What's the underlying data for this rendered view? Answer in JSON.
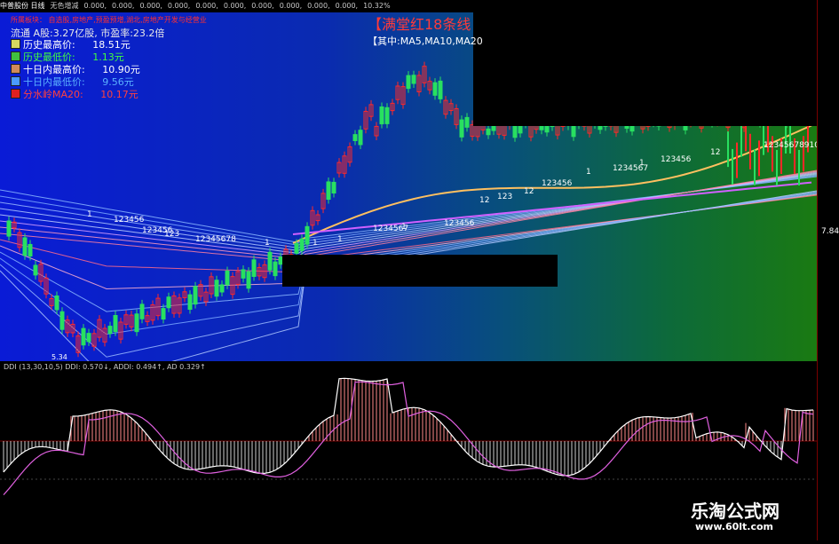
{
  "topbar": {
    "items": [
      "中普股份 日线",
      "无色增减",
      "0.000,",
      "0.000,",
      "0.000,",
      "0.000,",
      "0.000,",
      "0.000,",
      "0.000,",
      "0.000,",
      "0.000,",
      "0.000,",
      "10.32%"
    ]
  },
  "info": {
    "sector": "所属板块：  自选股,房地产,预盈预增,湖北,房地产开发与经营业",
    "flow": "流通 A股:3.27亿股,    市盈率:23.2倍",
    "legend": [
      {
        "label": "历史最高价:",
        "value": "18.51元",
        "color": "#d8d860",
        "text_color": "#ffffff"
      },
      {
        "label": "历史最低价:",
        "value": "1.13元",
        "color": "#40c040",
        "text_color": "#40ff40"
      },
      {
        "label": "十日内最高价:",
        "value": "10.90元",
        "color": "#d08a5a",
        "text_color": "#ffffff"
      },
      {
        "label": "十日内最低价:",
        "value": "9.56元",
        "color": "#4a9aff",
        "text_color": "#5ab0ff"
      },
      {
        "label": "分水岭MA20:",
        "value": "10.17元",
        "color": "#e02020",
        "text_color": "#ff4040"
      }
    ]
  },
  "banner": {
    "title": "【满堂红18条线",
    "subtitle": "【其中:MA5,MA10,MA20"
  },
  "chart_labels": {
    "upper_counts": [
      "1",
      "123456",
      "123456",
      "123",
      "12345678",
      "1",
      "1",
      "1",
      "1234567",
      "1",
      "123456",
      "12",
      "123",
      "12",
      "123456",
      "1",
      "1234567",
      "1",
      "123456",
      "12",
      "12345678910"
    ],
    "low_price": "5.34",
    "right_price": "7.84"
  },
  "indicator": {
    "header": "DDI (13,30,10,5)  DDI: 0.570↓, ADDI: 0.494↑, AD  0.329↑"
  },
  "watermark": {
    "line1": "乐淘公式网",
    "line2": "www.60lt.com"
  }
}
